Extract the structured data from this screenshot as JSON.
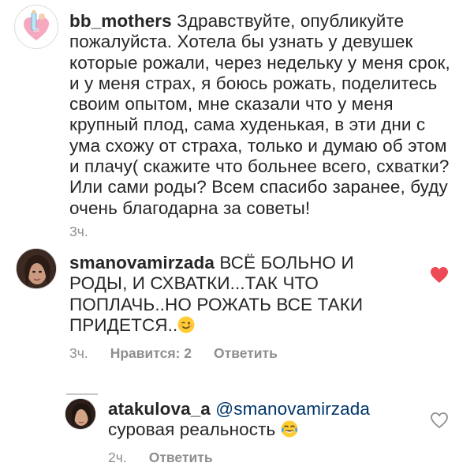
{
  "comments": [
    {
      "username": "bb_mothers",
      "avatar_icon": "baby-bottle-logo-icon",
      "text": " Здравствуйте,  опубликуйте пожалуйста. Хотела бы узнать у девушек которые рожали,  через недельку у меня срок, и у меня страх, я боюсь рожать, поделитесь своим опытом, мне сказали что у меня крупный плод, сама худенькая, в эти дни с ума схожу от страха, только и думаю об этом и плачу( скажите что больнее всего, схватки? Или сами роды? Всем спасибо заранее,  буду очень благодарна за советы!",
      "time": "3ч."
    },
    {
      "username": "smanovamirzada",
      "avatar_icon": "user-photo-avatar",
      "text": " ВСЁ БОЛЬНО И РОДЫ, И СХВАТКИ...ТАК ЧТО ПОПЛАЧЬ..НО РОЖАТЬ ВСЕ ТАКИ ПРИДЕТСЯ..",
      "emoji": "winking-face-emoji",
      "time": "3ч.",
      "likes": "Нравится: 2",
      "reply": "Ответить",
      "liked": true,
      "heart_color": "#ed4956"
    },
    {
      "username": "atakulova_a",
      "avatar_icon": "user-photo-avatar",
      "mention": "@smanovamirzada",
      "text": "суровая реальность",
      "emoji": "tears-of-joy-emoji",
      "time": "2ч.",
      "reply": "Ответить",
      "liked": false,
      "heart_color": "#8e8e8e"
    }
  ],
  "colors": {
    "text": "#262626",
    "meta": "#8e8e8e",
    "mention": "#003569"
  }
}
